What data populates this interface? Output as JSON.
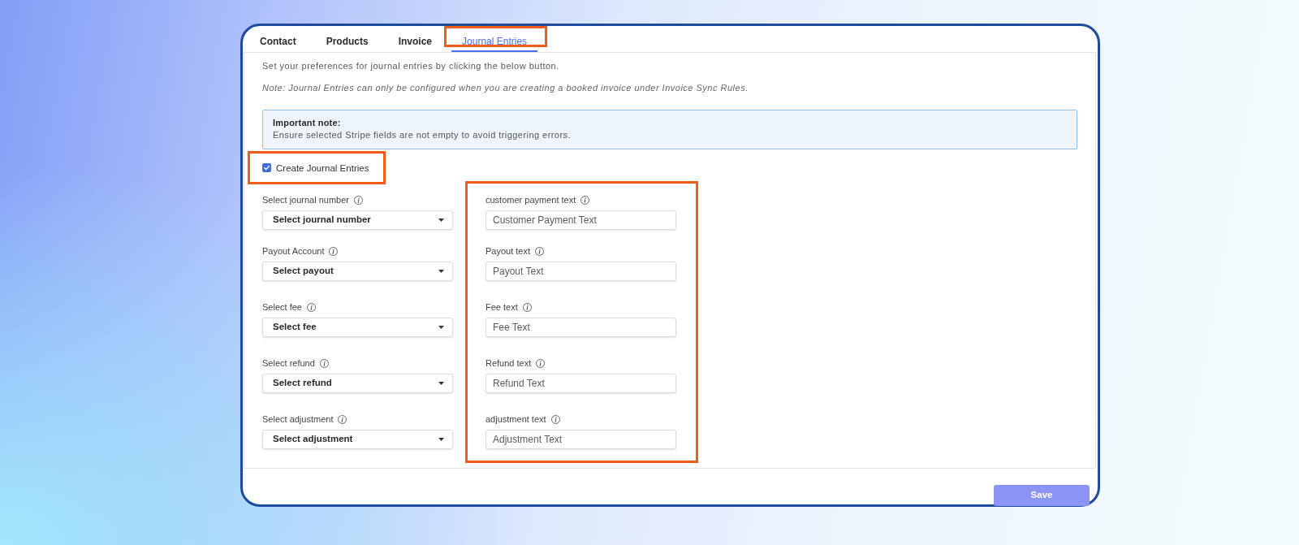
{
  "tabs": [
    {
      "label": "Contact",
      "selected": false,
      "highlighted": false
    },
    {
      "label": "Products",
      "selected": false,
      "highlighted": false
    },
    {
      "label": "Invoice",
      "selected": false,
      "highlighted": false
    },
    {
      "label": "Journal Entries",
      "selected": true,
      "highlighted": true
    }
  ],
  "intro": "Set your preferences for journal entries by clicking the below button.",
  "note": "Note: Journal Entries can only be configured when you are creating a booked invoice under Invoice Sync Rules.",
  "alert": {
    "title": "Important note:",
    "text": "Ensure selected Stripe fields are not empty to avoid triggering errors."
  },
  "create_journal_entries": {
    "label": "Create Journal Entries",
    "checked": true,
    "highlighted": true
  },
  "select_fields": [
    {
      "label": "Select journal number",
      "placeholder": "Select journal number"
    },
    {
      "label": "Payout Account",
      "placeholder": "Select payout"
    },
    {
      "label": "Select fee",
      "placeholder": "Select fee"
    },
    {
      "label": "Select refund",
      "placeholder": "Select refund"
    },
    {
      "label": "Select adjustment",
      "placeholder": "Select adjustment"
    }
  ],
  "text_fields": {
    "highlighted": true,
    "fields": [
      {
        "label": "customer payment text",
        "placeholder": "Customer Payment Text"
      },
      {
        "label": "Payout text",
        "placeholder": "Payout Text"
      },
      {
        "label": "Fee text",
        "placeholder": "Fee Text"
      },
      {
        "label": "Refund text",
        "placeholder": "Refund Text"
      },
      {
        "label": "adjustment text",
        "placeholder": "Adjustment Text"
      }
    ]
  },
  "save_button": {
    "label": "Save",
    "disabled": true
  }
}
